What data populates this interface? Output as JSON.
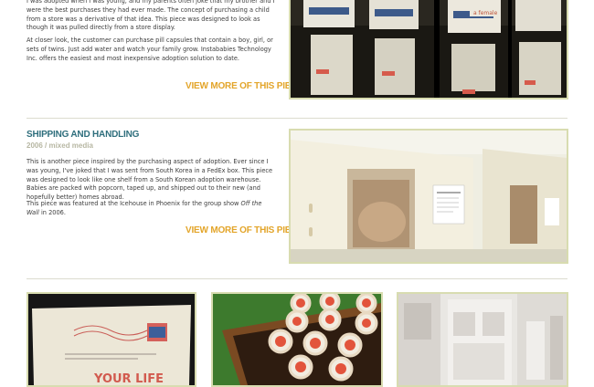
{
  "piece1": {
    "paragraph1": "I was adopted when I was young, and my parents often joke that my brother and I were the best purchases they had ever made. The concept of purchasing a child from a store was a derivative of that idea. This piece was designed to look as though it was pulled directly from a store display.",
    "paragraph2": "At closer look, the customer can purchase pill capsules that contain a boy, girl, or sets of twins. Just add water and watch your family grow. Instababies Technology Inc. offers the easiest and most inexpensive adoption solution to date.",
    "view_more": "VIEW MORE OF THIS PIECE »",
    "photo_alt": "Instababies pill capsule packages on store display racks",
    "package_text": "a female"
  },
  "piece2": {
    "title": "SHIPPING AND HANDLING",
    "subtitle": "2006 / mixed media",
    "paragraph1": "This is another piece inspired by the purchasing aspect of adoption. Ever since I was young, I've joked that I was sent from South Korea in a FedEx box. This piece was designed to look like one shelf from a South Korean adoption warehouse. Babies are packed with popcorn, taped up, and shipped out to their new (and hopefully better) homes abroad.",
    "paragraph2_before": "This piece was featured at the Icehouse in Phoenix for the group show ",
    "paragraph2_italic": "Off the Wall",
    "paragraph2_after": " in 2006.",
    "view_more": "VIEW MORE OF THIS PIECE »",
    "photo_alt": "Cardboard shipping boxes with windows showing packed babies"
  },
  "thumbnails": [
    {
      "alt": "Envelope mail piece",
      "text": "YOUR LIFE"
    },
    {
      "alt": "Sushi rolls in wooden tray"
    },
    {
      "alt": "White architectural model interior"
    }
  ],
  "colors": {
    "accent_orange": "#e3a52a",
    "title_teal": "#2e6e7c",
    "frame_border": "#d8dcb0",
    "divider": "#dcdccf"
  }
}
